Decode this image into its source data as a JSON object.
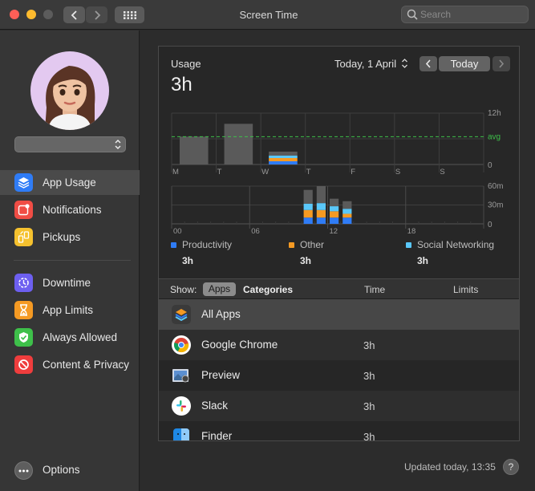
{
  "window": {
    "title": "Screen Time",
    "search_placeholder": "Search"
  },
  "sidebar": {
    "items": [
      {
        "label": "App Usage",
        "icon": "layers-icon",
        "color": "#2f7cf6",
        "active": true
      },
      {
        "label": "Notifications",
        "icon": "notification-badge-icon",
        "color": "#f04d45"
      },
      {
        "label": "Pickups",
        "icon": "pickup-icon",
        "color": "#f5c12e"
      },
      {
        "label": "Downtime",
        "icon": "downtime-icon",
        "color": "#6d5ff0"
      },
      {
        "label": "App Limits",
        "icon": "hourglass-icon",
        "color": "#f59a23"
      },
      {
        "label": "Always Allowed",
        "icon": "checkmark-shield-icon",
        "color": "#3ec04a"
      },
      {
        "label": "Content & Privacy",
        "icon": "no-entry-icon",
        "color": "#ef3d3d"
      }
    ],
    "options_label": "Options"
  },
  "usage": {
    "title": "Usage",
    "value": "3h",
    "date_label": "Today, 1 April",
    "today_button": "Today"
  },
  "chart_data": [
    {
      "type": "bar",
      "categories": [
        "M",
        "T",
        "W",
        "T",
        "F",
        "S",
        "S"
      ],
      "values": [
        6.5,
        9.5,
        3
      ],
      "yticks": [
        "12h",
        "avg",
        "0"
      ],
      "ylim": [
        0,
        12
      ],
      "avg": 6.5,
      "grid": true
    },
    {
      "type": "bar",
      "stacked": true,
      "x_ticks": [
        "00",
        "06",
        "12",
        "18"
      ],
      "yticks": [
        "60m",
        "30m",
        "0"
      ],
      "ylim": [
        0,
        60
      ],
      "hours": [
        10,
        11,
        12,
        13
      ],
      "series": [
        {
          "name": "Productivity",
          "color": "#2f7cf6",
          "values": [
            10,
            10,
            10,
            10
          ]
        },
        {
          "name": "Other",
          "color": "#f59a23",
          "values": [
            12,
            12,
            10,
            6
          ]
        },
        {
          "name": "Social Networking",
          "color": "#5ac8fa",
          "values": [
            10,
            11,
            8,
            8
          ]
        },
        {
          "name": "",
          "color": "#5a5a5a",
          "values": [
            22,
            27,
            12,
            12
          ]
        }
      ],
      "grid": true
    }
  ],
  "legend": [
    {
      "name": "Productivity",
      "color": "#2f7cf6",
      "value": "3h"
    },
    {
      "name": "Other",
      "color": "#f59a23",
      "value": "3h"
    },
    {
      "name": "Social Networking",
      "color": "#5ac8fa",
      "value": "3h"
    }
  ],
  "list": {
    "show_label": "Show:",
    "segment_apps": "Apps",
    "segment_categories": "Categories",
    "col_time": "Time",
    "col_limits": "Limits",
    "rows": [
      {
        "name": "All Apps",
        "time": "",
        "icon": "layers-icon"
      },
      {
        "name": "Google Chrome",
        "time": "3h",
        "icon": "chrome-icon"
      },
      {
        "name": "Preview",
        "time": "3h",
        "icon": "preview-icon"
      },
      {
        "name": "Slack",
        "time": "3h",
        "icon": "slack-icon"
      },
      {
        "name": "Finder",
        "time": "3h",
        "icon": "finder-icon"
      }
    ]
  },
  "footer": {
    "updated": "Updated today, 13:35",
    "help": "?"
  }
}
